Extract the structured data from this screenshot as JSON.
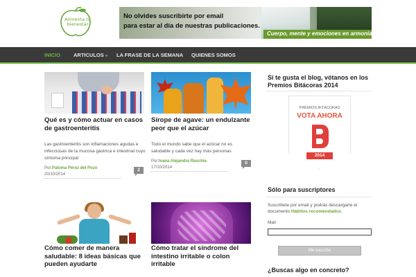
{
  "header": {
    "logo_text": "Alimenta tu bienestar",
    "banner_line1": "No olvides suscribirte por email",
    "banner_line2": "para estar al día de nuestras publicaciones.",
    "banner_tagline": "Cuerpo, mente y emociones en armonía"
  },
  "nav": {
    "items": [
      {
        "label": "INICIO",
        "active": true
      },
      {
        "label": "ARTICULOS",
        "has_submenu": true,
        "arrow": "»"
      },
      {
        "label": "LA FRASE DE LA SEMANA"
      },
      {
        "label": "QUIENES SOMOS"
      }
    ],
    "colors": {
      "bar": "#3a3a3a",
      "accent": "#6cb33f"
    }
  },
  "posts": [
    {
      "title": "Qué es y cómo actuar en casos de gastroenteritis",
      "excerpt": "Las gastroenteritis son inflamaciones agudas e infecciosas de la mucosa gástrica e intestinal cuyo síntoma principal",
      "author_prefix": "Por:",
      "author": "Paloma Pérez del Pozo",
      "date": "20/10/2014",
      "comments": "2"
    },
    {
      "title": "Sirope de agave: un endulzante peor que el azúcar",
      "excerpt": "Todo el mundo sabe que el azúcar no es saludable y cada vez hay más personas",
      "author_prefix": "Por:",
      "author": "Ivana Alejandra Raschia",
      "date": "17/10/2014",
      "comments": "0"
    },
    {
      "title": "Cómo comer de manera saludable: 8 ideas básicas que pueden ayudarte"
    },
    {
      "title": "Cómo tratar el síndrome del intestino irritable o colon irritable"
    }
  ],
  "sidebar": {
    "vote_title": "Si te gusta el blog, vótanos en los Premios Bitácoras 2014",
    "badge": {
      "premios": "PREMIOS BITÁCORAS",
      "vota": "VOTA AHORA",
      "year": "2014"
    },
    "subscribers_title": "Sólo para suscriptores",
    "subscribe_text": "Suscríbete por email y podrás descargarte el documento",
    "subscribe_link": "Hábitos recomendados",
    "subscribe_text_end": ".",
    "mail_label": "Mail",
    "mail_value": "",
    "subscribe_button": "Me suscribo",
    "search_title": "¿Buscas algo en concreto?"
  }
}
